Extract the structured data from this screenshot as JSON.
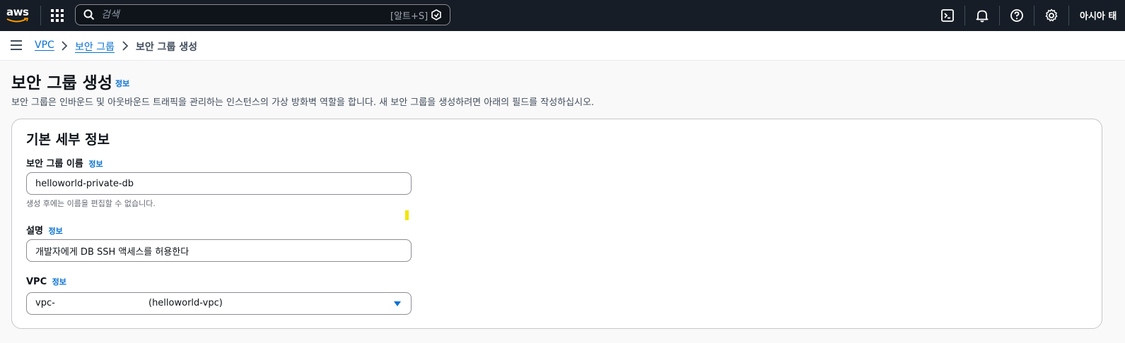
{
  "topnav": {
    "logo_text": "aws",
    "search_placeholder": "검색",
    "search_shortcut": "[알트+S]",
    "region": "아시아 태"
  },
  "breadcrumb": {
    "items": [
      "VPC",
      "보안 그룹"
    ],
    "current": "보안 그룹 생성"
  },
  "header": {
    "title": "보안 그룹 생성",
    "info": "정보",
    "description": "보안 그룹은 인바운드 및 아웃바운드 트래픽을 관리하는 인스턴스의 가상 방화벽 역할을 합니다. 새 보안 그룹을 생성하려면 아래의 필드를 작성하십시오."
  },
  "basic": {
    "title": "기본 세부 정보",
    "name_label": "보안 그룹 이름",
    "name_info": "정보",
    "name_value": "helloworld-private-db",
    "name_hint": "생성 후에는 이름을 편집할 수 없습니다.",
    "desc_label": "설명",
    "desc_info": "정보",
    "desc_value": "개발자에게 DB SSH 액세스를 허용한다",
    "vpc_label": "VPC",
    "vpc_info": "정보",
    "vpc_value_id": "vpc-",
    "vpc_value_name": "(helloworld-vpc)"
  },
  "colors": {
    "nav_bg": "#161d26",
    "link": "#0972d3",
    "text": "#0f141a"
  }
}
